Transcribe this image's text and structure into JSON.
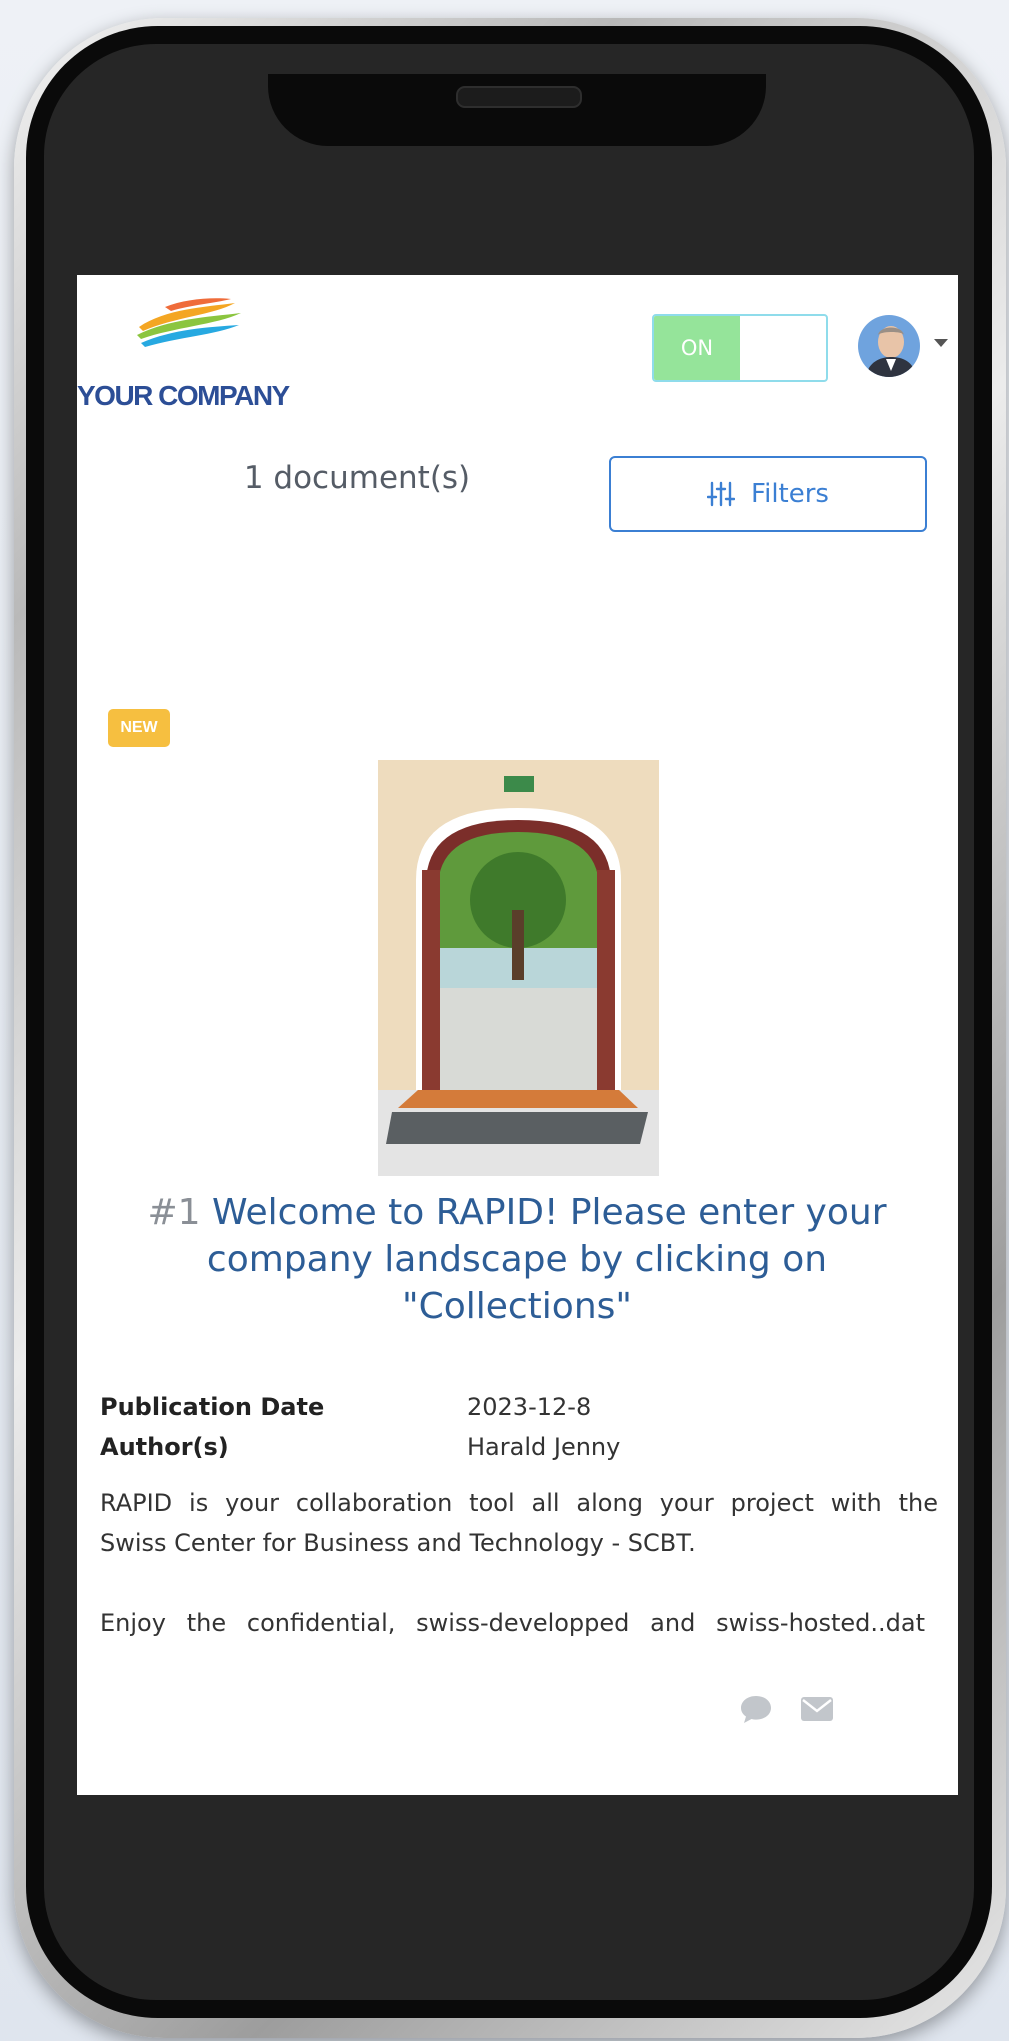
{
  "header": {
    "logo_text": "YOUR COMPANY",
    "toggle_label": "ON",
    "toggle_state": "on",
    "avatar": "user-avatar"
  },
  "toolbar": {
    "document_count": "1 document(s)",
    "filters_label": "Filters"
  },
  "document": {
    "badge": "NEW",
    "number": "#1",
    "title": "Welcome to RAPID! Please enter your company landscape by clicking on \"Collections\"",
    "image_alt": "open door to garden",
    "meta": [
      {
        "label": "Publication Date",
        "value": "2023-12-8"
      },
      {
        "label": "Author(s)",
        "value": "Harald Jenny"
      }
    ],
    "body_lines": [
      "RAPID is your collaboration tool all along your project with the",
      "Swiss Center for Business and Technology - SCBT.",
      "Enjoy the confidential, swiss-developped and swiss-hosted..dat"
    ],
    "actions": [
      "comment-icon",
      "mail-icon"
    ]
  },
  "colors": {
    "accent": "#3b7fd3",
    "title": "#2d5d96",
    "badge": "#f6bf40",
    "toggle_on": "#95e49a"
  }
}
